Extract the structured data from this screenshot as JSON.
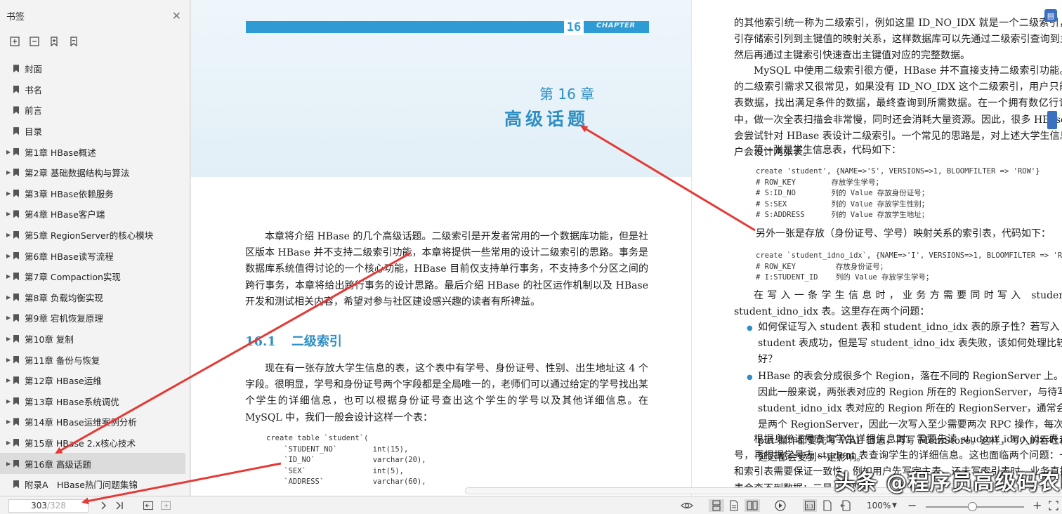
{
  "sidebar": {
    "title": "书签",
    "close": "✕",
    "items": [
      {
        "label": "封面",
        "expandable": false
      },
      {
        "label": "书名",
        "expandable": false
      },
      {
        "label": "前言",
        "expandable": false
      },
      {
        "label": "目录",
        "expandable": false
      },
      {
        "label": "第1章 HBase概述",
        "expandable": true
      },
      {
        "label": "第2章 基础数据结构与算法",
        "expandable": true
      },
      {
        "label": "第3章 HBase依赖服务",
        "expandable": true
      },
      {
        "label": "第4章 HBase客户端",
        "expandable": true
      },
      {
        "label": "第5章 RegionServer的核心模块",
        "expandable": true
      },
      {
        "label": "第6章 HBase读写流程",
        "expandable": true
      },
      {
        "label": "第7章 Compaction实现",
        "expandable": true
      },
      {
        "label": "第8章 负载均衡实现",
        "expandable": true
      },
      {
        "label": "第9章 宕机恢复原理",
        "expandable": true
      },
      {
        "label": "第10章 复制",
        "expandable": true
      },
      {
        "label": "第11章 备份与恢复",
        "expandable": true
      },
      {
        "label": "第12章 HBase运维",
        "expandable": true
      },
      {
        "label": "第13章 HBase系统调优",
        "expandable": true
      },
      {
        "label": "第14章 HBase运维案例分析",
        "expandable": true
      },
      {
        "label": "第15章 HBase 2.x核心技术",
        "expandable": true
      },
      {
        "label": "第16章 高级话题",
        "expandable": true,
        "selected": true
      },
      {
        "label": "附录A　HBase热门问题集锦",
        "expandable": false
      }
    ]
  },
  "left_page": {
    "chapter_bar_number": "16",
    "chapter_bar_word": "CHAPTER",
    "chapter_number": "第 16 章",
    "chapter_title": "高级话题",
    "intro": "本章将介绍 HBase 的几个高级话题。二级索引是开发者常用的一个数据库功能，但是社区版本 HBase 并不支持二级索引功能，本章将提供一些常用的设计二级索引的思路。事务是数据库系统值得讨论的一个核心功能，HBase 目前仅支持单行事务，不支持多个分区之间的跨行事务，本章将给出跨行事务的设计思路。最后介绍 HBase 的社区运作机制以及 HBase 开发和测试相关内容，希望对参与社区建设感兴趣的读者有所裨益。",
    "section_number": "16.1",
    "section_title": "二级索引",
    "section_para": "现在有一张存放大学生信息的表，这个表中有学号、身份证号、性别、出生地址这 4 个字段。很明显，学号和身份证号两个字段都是全局唯一的，老师们可以通过给定的学号找出某个学生的详细信息，也可以根据身份证号查出这个学生的学号以及其他详细信息。在 MySQL 中，我们一般会设计这样一个表：",
    "code": "create table `student`(\n    `STUDENT_NO`        int(15),\n    `ID_NO`             varchar(20),\n    `SEX`               int(5),\n    `ADDRESS`           varchar(60),"
  },
  "right_page": {
    "text1": "的其他索引统一称为二级索引，例如这里 ID_NO_IDX 就是一个二级索引，二级索引存储索引列到主键值的映射关系，这样数据库可以先通过二级索引查询到主键值，然后再通过主键索引快速查出主键值对应的完整数据。",
    "text2": "MySQL 中使用二级索引很方便，HBase 并不直接支持二级索引功能。但用户的二级索引需求又很常见，如果没有 ID_NO_IDX 这个二级索引，用户只能扫描全表数据，找出满足条件的数据，最终查询到所需数据。在一个拥有数亿行记录的表中，做一次全表扫描会非常慢，同时还会消耗大量资源。因此，很多 HBase 的用户会尝试针对 HBase 表设计二级索引。一个常见的思路是，对上述大学生信息表，用户会设计两张表。",
    "sub1": "第一张是学生信息表，代码如下：",
    "code1": "create 'student', {NAME=>'S', VERSIONS=>1, BLOOMFILTER => 'ROW'}\n# ROW_KEY        存放学生学号；\n# S:ID_NO        列的 Value 存放身份证号；\n# S:SEX          列的 Value 存放学生性别；\n# S:ADDRESS      列的 Value 存放学生地址；",
    "sub2": "另外一张是存放（身份证号、学号）映射关系的索引表，代码如下：",
    "code2": "create `student_idno_idx`, {NAME=>'I', VERSIONS=>1, BLOOMFILTER => 'ROW'}\n# ROW_KEY         存放身份证号；\n# I:STUDENT_ID    列的 Value 存放学生学号；",
    "text3": "在写入一条学生信息时，业务方需要同时写入 student 表和 student_idno_idx 表。这里存在两个问题：",
    "bullets": [
      "如何保证写入 student 表和 student_idno_idx 表的原子性？若写入 student 表成功，但是写 student_idno_idx 表失败，该如何处理比较好？",
      "HBase 的表会分成很多个 Region，落在不同的 RegionServer 上。因此一般来说，两张表对应的 Region 所在的 RegionServer，与待写 student_idno_idx 表对应的 Region 所在的 RegionServer，通常会是两个 RegionServer，因此一次写入至少需要两次 RPC 操作，每次 put 操作都要先写 WAL 日志，再写 MemStore。这样，写入的吞吐和延迟都会受到一定影响。"
    ],
    "text4": "根据身份证号查询学生详细信息时，需要先读 student_idno_idx 表，找到学号，再根据学号去 student 表查询学生的详细信息。这也面临两个问题：一是主表和索引表需要保证一致性，例如用户先写完主表，还未写索引表时，业务直接查索引表会查不到数据；二是从读取的"
  },
  "statusbar": {
    "current_page": "303",
    "total_pages": "/328",
    "zoom": "100%"
  },
  "watermark": "头条 @程序员高级码农II"
}
